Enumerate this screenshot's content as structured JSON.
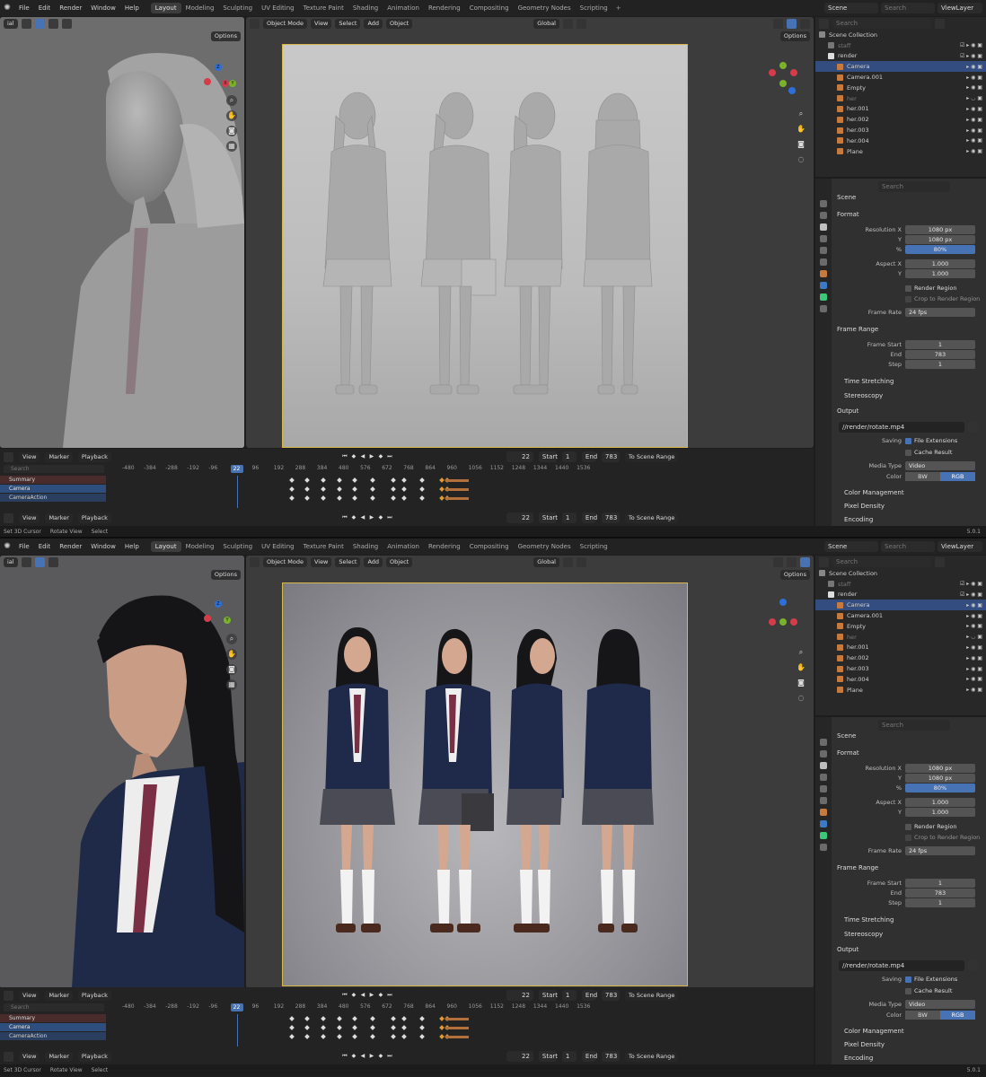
{
  "app": {
    "menu": [
      "File",
      "Edit",
      "Render",
      "Window",
      "Help"
    ],
    "workspaces": [
      "Layout",
      "Modeling",
      "Sculpting",
      "UV Editing",
      "Texture Paint",
      "Shading",
      "Animation",
      "Rendering",
      "Compositing",
      "Geometry Nodes",
      "Scripting"
    ],
    "active_workspace": "Layout",
    "scene": "Scene",
    "view_layer": "ViewLayer",
    "search_placeholder": "Search",
    "version": "5.0.1"
  },
  "viewport": {
    "mode": "Object Mode",
    "menus": [
      "View",
      "Select",
      "Add",
      "Object"
    ],
    "transform": "Global",
    "options": "Options",
    "left_mode_short": "ial",
    "gizmo_labels": {
      "z": "Z",
      "x": "X",
      "y": "Y"
    }
  },
  "outliner": {
    "title": "Scene Collection",
    "rows": [
      {
        "name": "staff",
        "kind": "collection",
        "selected": false
      },
      {
        "name": "render",
        "kind": "collection",
        "selected": false
      },
      {
        "name": "Camera",
        "kind": "camera",
        "selected": true
      },
      {
        "name": "Camera.001",
        "kind": "camera",
        "selected": false
      },
      {
        "name": "Empty",
        "kind": "empty",
        "selected": false
      },
      {
        "name": "her",
        "kind": "mesh",
        "selected": false
      },
      {
        "name": "her.001",
        "kind": "mesh",
        "selected": false
      },
      {
        "name": "her.002",
        "kind": "mesh",
        "selected": false
      },
      {
        "name": "her.003",
        "kind": "mesh",
        "selected": false
      },
      {
        "name": "her.004",
        "kind": "mesh",
        "selected": false
      },
      {
        "name": "Plane",
        "kind": "mesh",
        "selected": false
      }
    ]
  },
  "properties": {
    "context": "Scene",
    "sections": {
      "format": "Format",
      "frame_range": "Frame Range",
      "time_stretching": "Time Stretching",
      "stereoscopy": "Stereoscopy",
      "output": "Output",
      "color_management": "Color Management",
      "pixel_density": "Pixel Density",
      "encoding": "Encoding"
    },
    "resolution_x_label": "Resolution X",
    "resolution_x": "1080 px",
    "resolution_y_label": "Y",
    "resolution_y": "1080 px",
    "percent_label": "%",
    "percent": "80%",
    "aspect_x_label": "Aspect X",
    "aspect_x": "1.000",
    "aspect_y_label": "Y",
    "aspect_y": "1.000",
    "render_region": "Render Region",
    "crop": "Crop to Render Region",
    "frame_rate_label": "Frame Rate",
    "frame_rate": "24 fps",
    "frame_start_label": "Frame Start",
    "frame_start": "1",
    "end_label": "End",
    "end": "783",
    "step_label": "Step",
    "step": "1",
    "output_path": "//render/rotate.mp4",
    "saving_label": "Saving",
    "file_extensions": "File Extensions",
    "cache_result": "Cache Result",
    "media_type_label": "Media Type",
    "media_type": "Video",
    "color_label": "Color",
    "color_bw": "BW",
    "color_rgb": "RGB"
  },
  "timeline": {
    "menus": [
      "View",
      "Marker",
      "Playback"
    ],
    "current_frame": "22",
    "start_label": "Start",
    "start": "1",
    "end_label": "End",
    "end": "783",
    "scene_range": "To Scene Range",
    "ruler": [
      "-480",
      "-384",
      "-288",
      "-192",
      "-96",
      "22",
      "96",
      "192",
      "288",
      "384",
      "480",
      "576",
      "672",
      "768",
      "864",
      "960",
      "1056",
      "1152",
      "1248",
      "1344",
      "1440",
      "1536"
    ],
    "channels": [
      "Summary",
      "Camera",
      "CameraAction"
    ]
  },
  "status": [
    "Set 3D Cursor",
    "Rotate View",
    "Select"
  ],
  "colors": {
    "accent": "#4772b3",
    "selected_row": "#334d80",
    "camera_frame": "#d8b64a",
    "key_orange": "#e09a35"
  }
}
